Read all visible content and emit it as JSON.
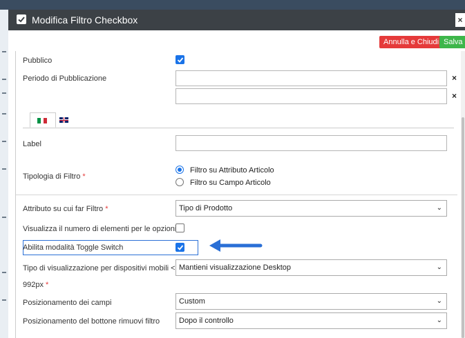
{
  "window": {
    "title": "Modifica Filtro Checkbox",
    "close_icon": "×"
  },
  "toolbar": {
    "cancel_label": "Annulla e Chiudi",
    "save_label": "Salva"
  },
  "form": {
    "pubblico": {
      "label": "Pubblico",
      "checked": true
    },
    "periodo": {
      "label": "Periodo di Pubblicazione",
      "clear1": "×",
      "clear2": "×"
    },
    "tabs": [
      {
        "name": "it",
        "active": true
      },
      {
        "name": "en",
        "active": false
      }
    ],
    "label_field": {
      "label": "Label",
      "value": ""
    },
    "tipologia": {
      "label": "Tipologia di Filtro",
      "required_mark": "*",
      "options": [
        "Filtro su Attributo Articolo",
        "Filtro su Campo Articolo"
      ],
      "selected_index": 0
    },
    "attributo": {
      "label": "Attributo su cui far Filtro",
      "required_mark": "*",
      "value": "Tipo di Prodotto"
    },
    "visualizza_numero": {
      "label": "Visualizza il numero di elementi per le opzioni",
      "checked": false
    },
    "toggle_switch": {
      "label": "Abilita modalità Toggle Switch",
      "checked": true
    },
    "mobile": {
      "label": "Tipo di visualizzazione per dispositivi mobili <",
      "label2": "992px",
      "required_mark": "*",
      "value": "Mantieni visualizzazione Desktop"
    },
    "posizionamento_campi": {
      "label": "Posizionamento dei campi",
      "value": "Custom"
    },
    "posizionamento_bottone": {
      "label": "Posizionamento del bottone rimuovi filtro",
      "value": "Dopo il controllo"
    }
  },
  "colors": {
    "titlebar": "#3c4146",
    "cancel": "#e53a3a",
    "save": "#3db64a",
    "accent": "#1a73e8",
    "annotation_arrow": "#2a6fd6"
  }
}
